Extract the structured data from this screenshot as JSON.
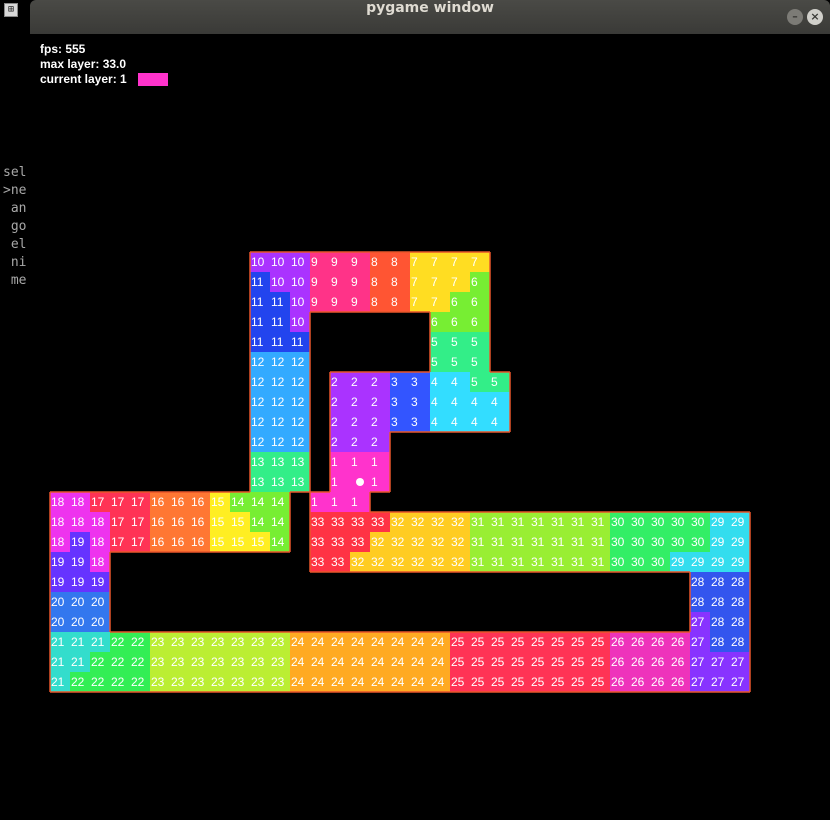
{
  "window": {
    "title": "pygame window"
  },
  "desktop": {
    "corner_icon": "⊞",
    "side_text_lines": [
      "sel",
      ">ne",
      " an",
      " go",
      " el",
      " ni",
      " me"
    ]
  },
  "hud": {
    "fps_text": "fps: 555",
    "max_layer_text": "max layer: 33.0",
    "current_layer_text": "current layer: 1",
    "current_layer_color": "#ff33cc"
  },
  "layer_colors": {
    "1": "#ff33cc",
    "2": "#aa33ff",
    "3": "#3355ff",
    "4": "#33ddff",
    "5": "#33ee88",
    "6": "#77ee33",
    "7": "#ffdd22",
    "8": "#ff5533",
    "9": "#ff3388",
    "10": "#aa33ff",
    "11": "#2244ee",
    "12": "#33aaff",
    "13": "#33ee88",
    "14": "#77ee33",
    "15": "#ffee22",
    "16": "#ff7733",
    "17": "#ff3355",
    "18": "#ee33ee",
    "19": "#6633ff",
    "20": "#3377ee",
    "21": "#33ddcc",
    "22": "#33ee55",
    "23": "#bbee33",
    "24": "#ffaa22",
    "25": "#ff3355",
    "26": "#ee33bb",
    "27": "#8833ff",
    "28": "#3355ee",
    "29": "#33ddee",
    "30": "#33ee66",
    "31": "#99ee33",
    "32": "#ffcc22",
    "33": "#ff3344"
  },
  "grid": {
    "origin_row": 0,
    "origin_col": 0,
    "rows": [
      "..........10,10,10,9,9,9,8,8,7,7,7,7",
      "..........11,10,10,9,9,9,8,8,7,7,7,6",
      "..........11,11,10,9,9,9,8,8,7,7,6,6",
      "..........11,11,10,.,.,.,.,.,.,6,6,6",
      "..........11,11,11,.,.,.,.,.,.,5,5,5",
      "..........12,12,12,.,.,.,.,.,.,5,5,5",
      "..........12,12,12,.,2,2,2,3,3,4,4,5,5",
      "..........12,12,12,.,2,2,2,3,3,4,4,4,4",
      "..........12,12,12,.,2,2,2,3,3,4,4,4,4",
      "..........12,12,12,.,2,2,2",
      "..........13,13,13,.,1,1,1",
      "..........13,13,13,.,1,*,1",
      "18,18,17,17,17,16,16,16,15,14,14,14,.,1,1,1",
      "18,18,18,17,17,16,16,16,15,15,14,14,.,33,33,33,33,32,32,32,32,31,31,31,31,31,31,31,30,30,30,30,30,29,29",
      "18,19,18,17,17,16,16,16,15,15,15,14,.,33,33,33,32,32,32,32,32,31,31,31,31,31,31,31,30,30,30,30,30,29,29",
      "19,19,18,.,.,.,.,.,.,.,.,.,.,33,33,32,32,32,32,32,32,31,31,31,31,31,31,31,30,30,30,29,29,29,29",
      "19,19,19,.,.,.,.,.,.,.,.,.,.,.,.,.,.,.,.,.,.,.,.,.,.,.,.,.,.,.,.,.,28,28,28",
      "20,20,20,.,.,.,.,.,.,.,.,.,.,.,.,.,.,.,.,.,.,.,.,.,.,.,.,.,.,.,.,.,28,28,28",
      "20,20,20,.,.,.,.,.,.,.,.,.,.,.,.,.,.,.,.,.,.,.,.,.,.,.,.,.,.,.,.,.,27,28,28",
      "21,21,21,22,22,23,23,23,23,23,23,23,24,24,24,24,24,24,24,24,25,25,25,25,25,25,25,25,26,26,26,26,27,28,28",
      "21,21,22,22,22,23,23,23,23,23,23,23,24,24,24,24,24,24,24,24,25,25,25,25,25,25,25,25,26,26,26,26,27,27,27",
      "21,22,22,22,22,23,23,23,23,23,23,23,24,24,24,24,24,24,24,24,25,25,25,25,25,25,25,25,26,26,26,26,27,27,27"
    ]
  }
}
